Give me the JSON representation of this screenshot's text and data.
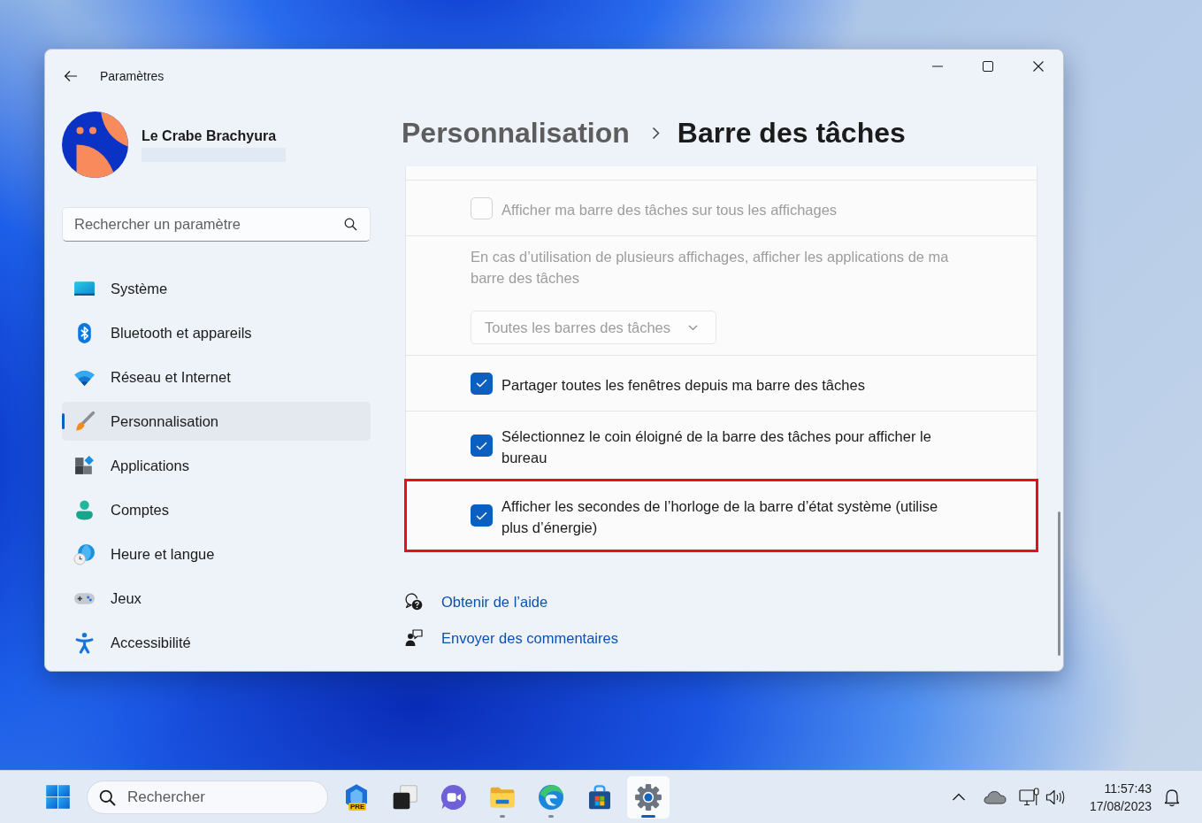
{
  "window": {
    "title": "Paramètres"
  },
  "profile": {
    "name": "Le Crabe Brachyura"
  },
  "search": {
    "placeholder": "Rechercher un paramètre"
  },
  "nav": [
    {
      "kind": "system",
      "label": "Système",
      "selected": false
    },
    {
      "kind": "bluetooth",
      "label": "Bluetooth et appareils",
      "selected": false
    },
    {
      "kind": "network",
      "label": "Réseau et Internet",
      "selected": false
    },
    {
      "kind": "personalization",
      "label": "Personnalisation",
      "selected": true
    },
    {
      "kind": "apps",
      "label": "Applications",
      "selected": false
    },
    {
      "kind": "accounts",
      "label": "Comptes",
      "selected": false
    },
    {
      "kind": "time",
      "label": "Heure et langue",
      "selected": false
    },
    {
      "kind": "gaming",
      "label": "Jeux",
      "selected": false
    },
    {
      "kind": "accessibility",
      "label": "Accessibilité",
      "selected": false
    }
  ],
  "breadcrumb": {
    "parent": "Personnalisation",
    "current": "Barre des tâches"
  },
  "settings": [
    {
      "kind": "checkbox",
      "label": "Afficher ma barre des tâches sur tous les affichages",
      "checked": false,
      "disabled": true,
      "highlighted": false
    },
    {
      "kind": "dropdown",
      "label": "En cas d’utilisation de plusieurs affichages, afficher les applications de ma barre des tâches",
      "value": "Toutes les barres des tâches",
      "disabled": true,
      "highlighted": false
    },
    {
      "kind": "checkbox",
      "label": "Partager toutes les fenêtres depuis ma barre des tâches",
      "checked": true,
      "disabled": false,
      "highlighted": false
    },
    {
      "kind": "checkbox",
      "label": "Sélectionnez le coin éloigné de la barre des tâches pour afficher le bureau",
      "checked": true,
      "disabled": false,
      "highlighted": false
    },
    {
      "kind": "checkbox",
      "label": "Afficher les secondes de l’horloge de la barre d’état système (utilise plus d’énergie)",
      "checked": true,
      "disabled": false,
      "highlighted": true
    }
  ],
  "links": [
    {
      "kind": "help",
      "label": "Obtenir de l’aide"
    },
    {
      "kind": "feedback",
      "label": "Envoyer des commentaires"
    }
  ],
  "taskbar": {
    "search": {
      "placeholder": "Rechercher"
    },
    "apps": [
      {
        "kind": "hexagon",
        "badge": "PRE",
        "running": false,
        "selected": false
      },
      {
        "kind": "windows",
        "running": false,
        "selected": false
      },
      {
        "kind": "chat",
        "running": false,
        "selected": false
      },
      {
        "kind": "folder",
        "running": true,
        "selected": false
      },
      {
        "kind": "browser",
        "running": true,
        "selected": false
      },
      {
        "kind": "store",
        "running": false,
        "selected": false
      },
      {
        "kind": "gear",
        "running": true,
        "selected": true
      }
    ],
    "clock": {
      "time": "11:57:43",
      "date": "17/08/2023"
    }
  }
}
